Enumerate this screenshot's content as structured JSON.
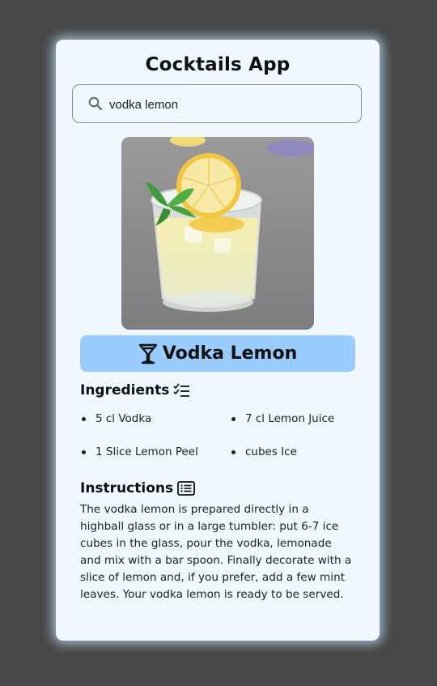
{
  "app": {
    "title": "Cocktails App"
  },
  "search": {
    "value": "vodka lemon",
    "icon": "search-icon"
  },
  "drink": {
    "name": "Vodka Lemon",
    "icon": "cocktail-glass-icon",
    "image_description": "lemonade drink with ice, lemon slices and mint"
  },
  "ingredients": {
    "heading": "Ingredients",
    "icon": "checklist-icon",
    "items": [
      "5 cl Vodka",
      "7 cl Lemon Juice",
      "1 Slice Lemon Peel",
      "cubes Ice"
    ]
  },
  "instructions": {
    "heading": "Instructions",
    "icon": "list-icon",
    "text": "The vodka lemon is prepared directly in a highball glass or in a large tumbler: put 6-7 ice cubes in the glass, pour the vodka, lemonade and mix with a bar spoon. Finally decorate with a slice of lemon and, if you prefer, add a few mint leaves. Your vodka lemon is ready to be served."
  },
  "colors": {
    "background": "#474747",
    "card": "#f0f7ff",
    "accent": "#99cbfd"
  }
}
